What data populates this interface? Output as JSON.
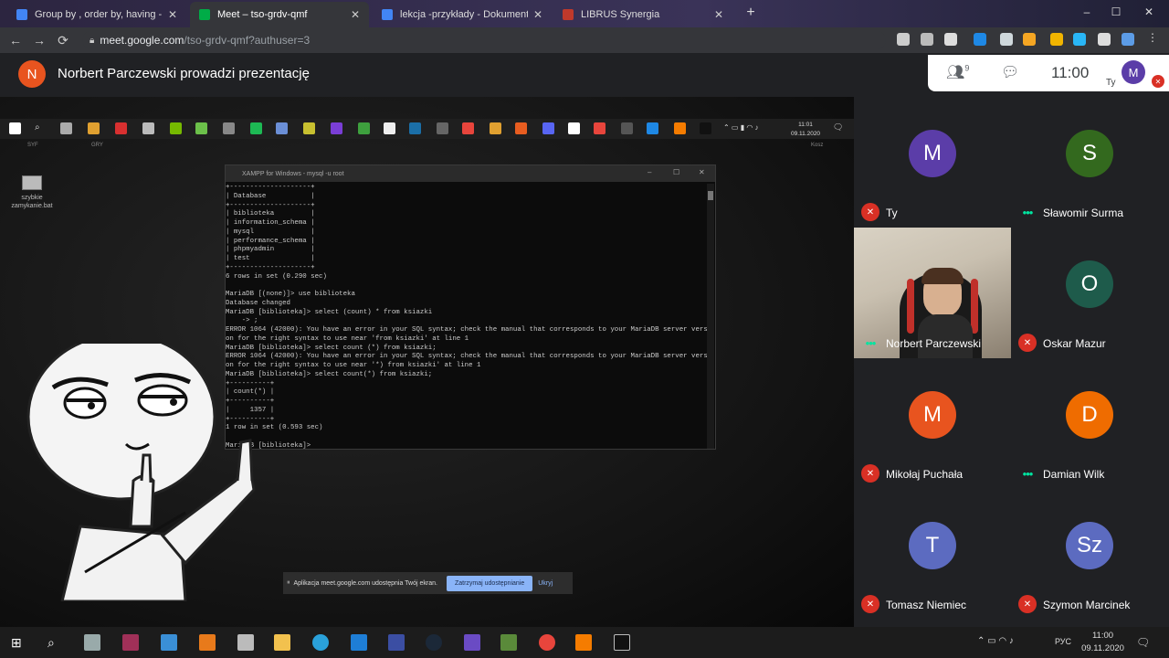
{
  "browser": {
    "tabs": [
      {
        "title": "Group by , order by, having - po",
        "favicon_color": "#4285f4",
        "active": false
      },
      {
        "title": "Meet – tso-grdv-qmf",
        "favicon_color": "#00ac47",
        "active": true
      },
      {
        "title": "lekcja -przykłady - Dokumenty G",
        "favicon_color": "#4285f4",
        "active": false
      },
      {
        "title": "LIBRUS Synergia",
        "favicon_color": "#c0392b",
        "active": false
      }
    ],
    "new_tab_label": "+",
    "url_host": "meet.google.com",
    "url_path": "/tso-grdv-qmf?authuser=3",
    "window_controls": {
      "minimize": "–",
      "maximize": "☐",
      "close": "✕"
    }
  },
  "presenter": {
    "avatar_initial": "N",
    "text": "Norbert Parczewski prowadzi prezentację"
  },
  "meet_panel": {
    "participants_count": "9",
    "time": "11:00",
    "self_initial": "M",
    "self_label": "Ty"
  },
  "remote_screen": {
    "taskbar_labels": {
      "syf": "SYF",
      "gry": "GRY",
      "kosz": "Kosz"
    },
    "clock_time": "11:01",
    "clock_date": "09.11.2020",
    "desktop_icon_label": "szybkie zamykanie.bat",
    "terminal_title": "XAMPP for Windows - mysql  -u root",
    "terminal_lines": [
      "+--------------------+",
      "| Database           |",
      "+--------------------+",
      "| biblioteka         |",
      "| information_schema |",
      "| mysql              |",
      "| performance_schema |",
      "| phpmyadmin         |",
      "| test               |",
      "+--------------------+",
      "6 rows in set (0.290 sec)",
      "",
      "MariaDB [(none)]> use biblioteka",
      "Database changed",
      "MariaDB [biblioteka]> select (count) * from ksiazki",
      "    -> ;",
      "ERROR 1064 (42000): You have an error in your SQL syntax; check the manual that corresponds to your MariaDB server versi",
      "on for the right syntax to use near 'from ksiazki' at line 1",
      "MariaDB [biblioteka]> select count (*) from ksiazki;",
      "ERROR 1064 (42000): You have an error in your SQL syntax; check the manual that corresponds to your MariaDB server versi",
      "on for the right syntax to use near '*) from ksiazki' at line 1",
      "MariaDB [biblioteka]> select count(*) from ksiazki;",
      "+----------+",
      "| count(*) |",
      "+----------+",
      "|     1357 |",
      "+----------+",
      "1 row in set (0.593 sec)",
      "",
      "MariaDB [biblioteka]>"
    ],
    "share_notice": "Aplikacja meet.google.com udostępnia Twój ekran.",
    "stop_sharing_label": "Zatrzymaj udostępnianie",
    "hide_label": "Ukryj"
  },
  "participants": [
    {
      "name": "Ty",
      "initial": "M",
      "color": "#5b3da8",
      "status": "muted",
      "video": false
    },
    {
      "name": "Sławomir Surma",
      "initial": "S",
      "color": "#33691e",
      "status": "speaking",
      "video": false
    },
    {
      "name": "Norbert Parczewski",
      "initial": "N",
      "color": "#e8541f",
      "status": "speaking",
      "video": true
    },
    {
      "name": "Oskar Mazur",
      "initial": "O",
      "color": "#1e5b4b",
      "status": "muted",
      "video": false
    },
    {
      "name": "Mikołaj Puchała",
      "initial": "M",
      "color": "#e8541f",
      "status": "muted",
      "video": false
    },
    {
      "name": "Damian Wilk",
      "initial": "D",
      "color": "#ef6c00",
      "status": "speaking",
      "video": false
    },
    {
      "name": "Tomasz Niemiec",
      "initial": "T",
      "color": "#5c6bc0",
      "status": "muted",
      "video": false
    },
    {
      "name": "Szymon Marcinek",
      "initial": "Sz",
      "color": "#5c6bc0",
      "status": "muted",
      "video": false
    }
  ],
  "windows_taskbar": {
    "language": "РУС",
    "time": "11:00",
    "date": "09.11.2020",
    "notification_count": "2"
  }
}
